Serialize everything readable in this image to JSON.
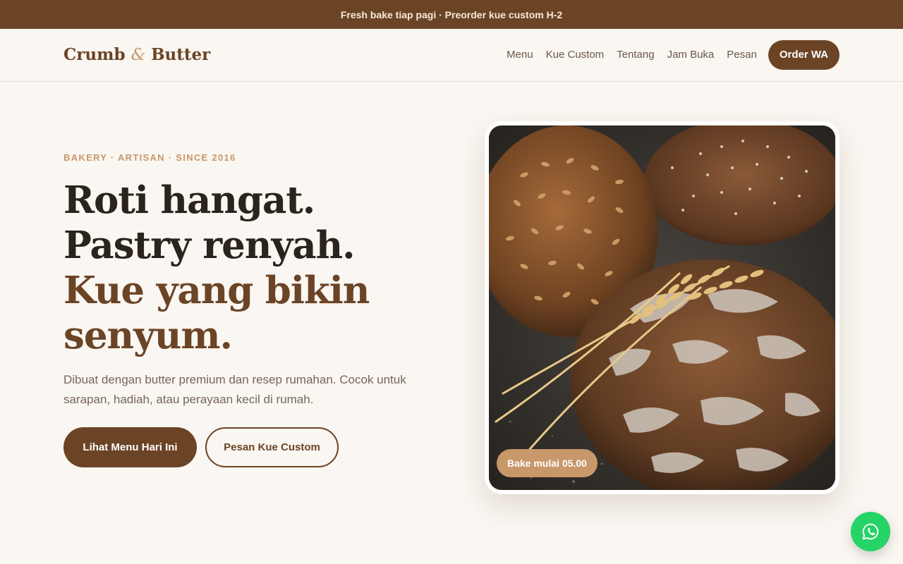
{
  "topbar": {
    "text": "Fresh bake tiap pagi · Preorder kue custom H-2"
  },
  "brand": {
    "name_part1": "Crumb",
    "ampersand": "&",
    "name_part2": "Butter"
  },
  "nav": {
    "items": [
      {
        "label": "Menu"
      },
      {
        "label": "Kue Custom"
      },
      {
        "label": "Tentang"
      },
      {
        "label": "Jam Buka"
      },
      {
        "label": "Pesan"
      }
    ],
    "order_label": "Order WA"
  },
  "hero": {
    "eyebrow": "BAKERY · ARTISAN · SINCE 2016",
    "headline": {
      "line1": "Roti hangat.",
      "line2": "Pastry renyah.",
      "line3": "Kue yang bikin senyum."
    },
    "description": "Dibuat dengan butter premium dan resep rumahan. Cocok untuk sarapan, hadiah, atau perayaan kecil di rumah.",
    "primary_button": "Lihat Menu Hari Ini",
    "secondary_button": "Pesan Kue Custom"
  },
  "photo": {
    "subject_icon": "bread-loaves-icon",
    "badge": "Bake mulai 05.00"
  },
  "floating": {
    "icon": "whatsapp-icon"
  },
  "colors": {
    "brand_brown": "#6b4426",
    "accent_tan": "#c8976a",
    "background": "#faf6f1",
    "whatsapp_green": "#25d366"
  }
}
